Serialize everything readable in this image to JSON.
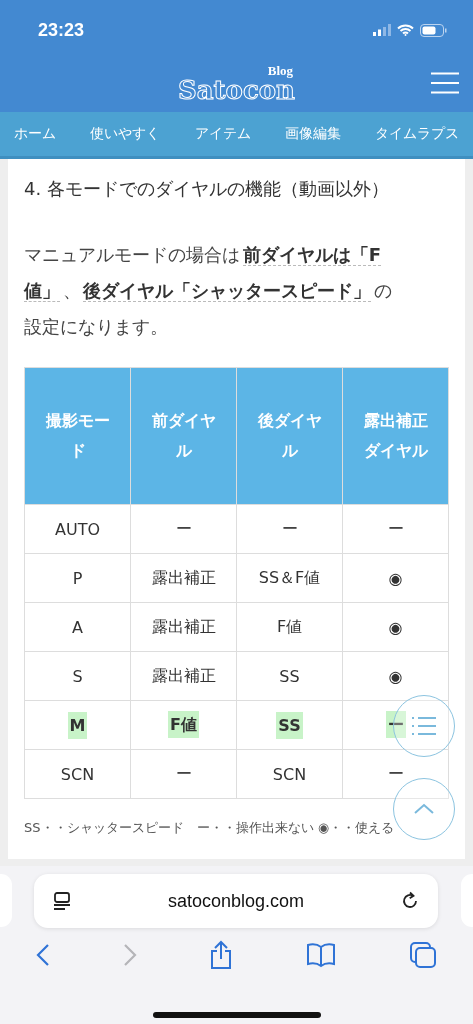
{
  "status_bar": {
    "time": "23:23"
  },
  "header": {
    "logo": "Satocon",
    "logo_sup": "Blog"
  },
  "nav": {
    "items": [
      {
        "label": "ホーム"
      },
      {
        "label": "使いやすく"
      },
      {
        "label": "アイテム"
      },
      {
        "label": "画像編集"
      },
      {
        "label": "タイムラプス"
      }
    ]
  },
  "article": {
    "heading": "4. 各モードでのダイヤルの機能（動画以外）",
    "paragraph": "マニュアルモードの場合は **前ダイヤルは「F値」** 、 **後ダイヤル「シャッタースピード」** の設定になります。",
    "table": {
      "columns": [
        "撮影モード",
        "前ダイヤル",
        "後ダイヤル",
        "露出補正ダイヤル"
      ],
      "rows": [
        {
          "cells": [
            "AUTO",
            "ー",
            "ー",
            "ー"
          ],
          "highlighted": false
        },
        {
          "cells": [
            "P",
            "露出補正",
            "SS＆F値",
            "◉"
          ],
          "highlighted": false
        },
        {
          "cells": [
            "A",
            "露出補正",
            "F値",
            "◉"
          ],
          "highlighted": false
        },
        {
          "cells": [
            "S",
            "露出補正",
            "SS",
            "◉"
          ],
          "highlighted": false
        },
        {
          "cells": [
            "M",
            "F値",
            "SS",
            "ー"
          ],
          "highlighted": true
        },
        {
          "cells": [
            "SCN",
            "ー",
            "SCN",
            "ー"
          ],
          "highlighted": false
        }
      ]
    },
    "note": "SS・・シャッタースピード　ー・・操作出来ない ◉・・使える"
  },
  "browser": {
    "url": "satoconblog.com",
    "forward_disabled": true
  }
}
